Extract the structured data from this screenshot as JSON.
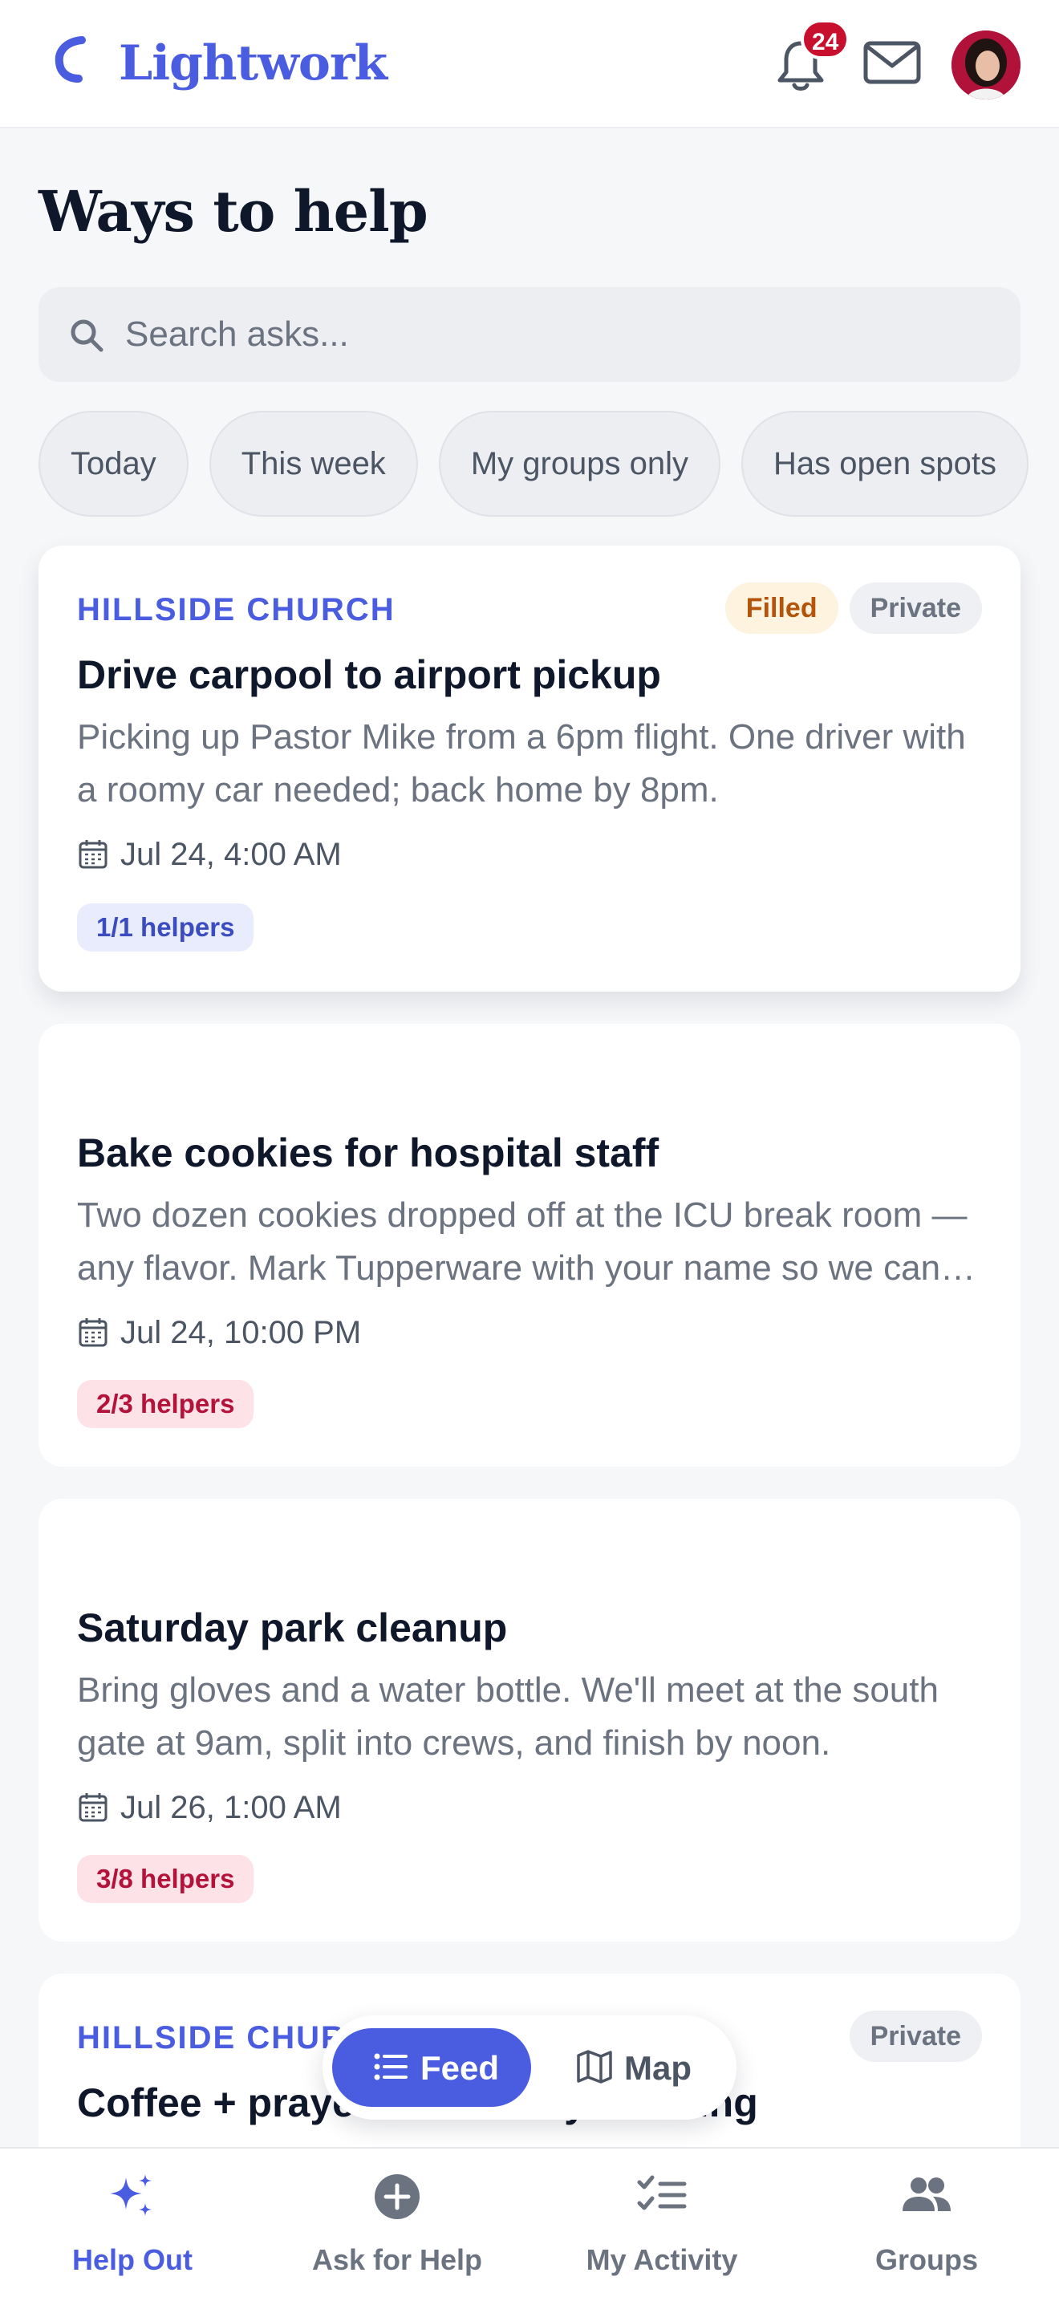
{
  "header": {
    "brand": "Lightwork",
    "notification_count": "24"
  },
  "page": {
    "title": "Ways to help"
  },
  "search": {
    "placeholder": "Search asks..."
  },
  "filters": [
    "Today",
    "This week",
    "My groups only",
    "Has open spots"
  ],
  "cards": [
    {
      "group": "HILLSIDE CHURCH",
      "tags": [
        "Filled",
        "Private"
      ],
      "title": "Drive carpool to airport pickup",
      "description": "Picking up Pastor Mike from a 6pm flight. One driver with a roomy car needed; back home by 8pm.",
      "date": "Jul 24, 4:00 AM",
      "helpers": "1/1 helpers"
    },
    {
      "title": "Bake cookies for hospital staff",
      "description": "Two dozen cookies dropped off at the ICU break room — any flavor. Mark Tupperware with your name so we can return it.",
      "date": "Jul 24, 10:00 PM",
      "helpers": "2/3 helpers"
    },
    {
      "title": "Saturday park cleanup",
      "description": "Bring gloves and a water bottle. We'll meet at the south gate at 9am, split into crews, and finish by noon.",
      "date": "Jul 26, 1:00 AM",
      "helpers": "3/8 helpers"
    },
    {
      "group": "HILLSIDE CHURCH",
      "tags": [
        "Private"
      ],
      "title": "Coffee + prayer on Sunday morning"
    }
  ],
  "view_toggle": {
    "feed": "Feed",
    "map": "Map"
  },
  "tabs": [
    {
      "label": "Help Out",
      "icon": "sparkles-icon",
      "active": true
    },
    {
      "label": "Ask for Help",
      "icon": "plus-circle-icon",
      "active": false
    },
    {
      "label": "My Activity",
      "icon": "checklist-icon",
      "active": false
    },
    {
      "label": "Groups",
      "icon": "people-icon",
      "active": false
    }
  ],
  "colors": {
    "accent": "#4a5ce0",
    "danger": "#c8102e",
    "filled": "#b45309",
    "background": "#f6f7f9"
  }
}
